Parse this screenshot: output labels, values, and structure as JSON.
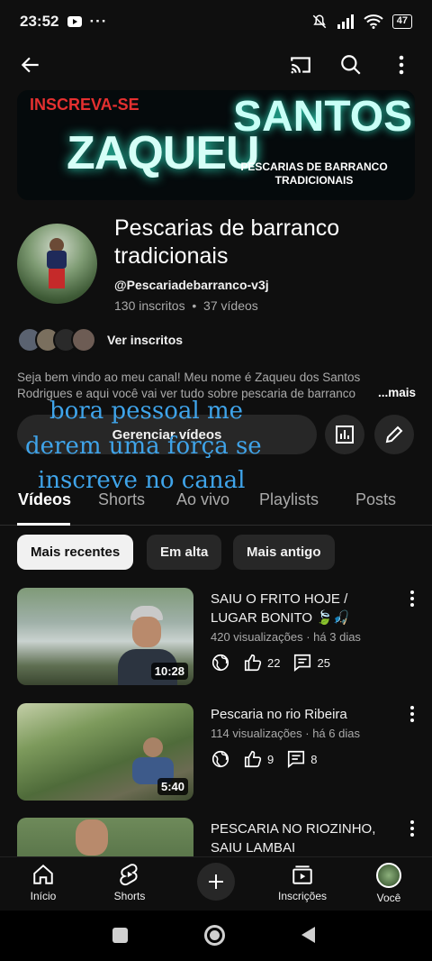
{
  "status": {
    "time": "23:52",
    "dots": "···",
    "battery": "47"
  },
  "banner": {
    "line1": "INSCREVA-SE",
    "line2": "SANTOS",
    "line3": "ZAQUEU",
    "line4": "PESCARIAS DE BARRANCO TRADICIONAIS"
  },
  "channel": {
    "name": "Pescarias de barranco tradicionais",
    "handle": "@Pescariadebarranco-v3j",
    "stats": "130 inscritos  •  37 vídeos",
    "subs_label": "Ver inscritos",
    "description": "Seja bem vindo ao meu canal! Meu nome é Zaqueu dos Santos Rodrigues e aqui você vai ver tudo sobre pescaria de barranco",
    "more": "...mais",
    "manage": "Gerenciar vídeos"
  },
  "overlay": {
    "line1": "bora pessoal me",
    "line2": "derem uma força se",
    "line3": "inscreve no canal"
  },
  "tabs": [
    "Vídeos",
    "Shorts",
    "Ao vivo",
    "Playlists",
    "Posts"
  ],
  "chips": [
    "Mais recentes",
    "Em alta",
    "Mais antigo"
  ],
  "videos": [
    {
      "title": "SAIU O FRITO HOJE / LUGAR BONITO 🍃🎣",
      "meta": "420 visualizações · há 3 dias",
      "likes": "22",
      "comments": "25",
      "duration": "10:28"
    },
    {
      "title": "Pescaria no rio Ribeira",
      "meta": "114 visualizações · há 6 dias",
      "likes": "9",
      "comments": "8",
      "duration": "5:40"
    },
    {
      "title": "PESCARIA NO RIOZINHO, SAIU LAMBAI"
    }
  ],
  "nav": {
    "home": "Início",
    "shorts": "Shorts",
    "subs": "Inscrições",
    "you": "Você"
  }
}
